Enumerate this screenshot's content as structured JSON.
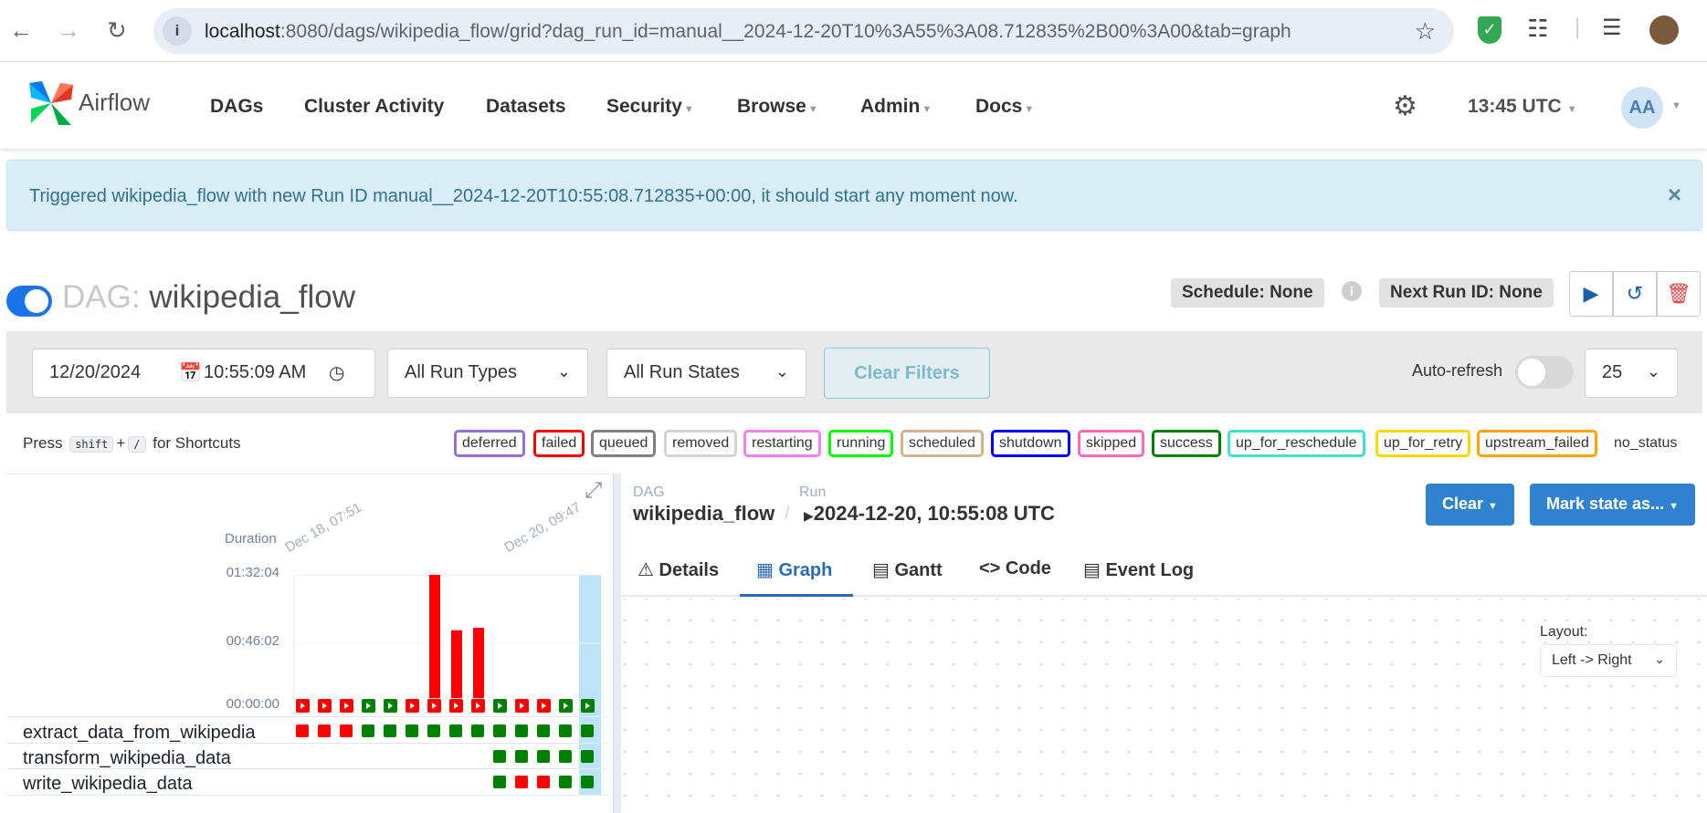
{
  "browser": {
    "url_host": "localhost",
    "url_rest": ":8080/dags/wikipedia_flow/grid?dag_run_id=manual__2024-12-20T10%3A55%3A08.712835%2B00%3A00&tab=graph"
  },
  "navbar": {
    "brand": "Airflow",
    "items": [
      "DAGs",
      "Cluster Activity",
      "Datasets",
      "Security",
      "Browse",
      "Admin",
      "Docs"
    ],
    "time": "13:45 UTC",
    "user_initials": "AA"
  },
  "alert": {
    "message": "Triggered wikipedia_flow with new Run ID manual__2024-12-20T10:55:08.712835+00:00, it should start any moment now.",
    "close": "×"
  },
  "dag": {
    "label": "DAG:",
    "name": "wikipedia_flow",
    "schedule": "Schedule: None",
    "next_run": "Next Run ID: None"
  },
  "filters": {
    "date": "12/20/2024",
    "time": "10:55:09  AM",
    "run_types": "All Run Types",
    "run_states": "All Run States",
    "clear_filters": "Clear Filters",
    "auto_refresh": "Auto-refresh",
    "page_size": "25"
  },
  "shortcuts": {
    "press": "Press",
    "key1": "shift",
    "plus": "+",
    "key2": "/",
    "suffix": "for Shortcuts"
  },
  "states": [
    {
      "label": "deferred",
      "color": "#9370db"
    },
    {
      "label": "failed",
      "color": "#ff0000"
    },
    {
      "label": "queued",
      "color": "#808080"
    },
    {
      "label": "removed",
      "color": "#d3d3d3"
    },
    {
      "label": "restarting",
      "color": "#ee82ee"
    },
    {
      "label": "running",
      "color": "#00ff00"
    },
    {
      "label": "scheduled",
      "color": "#d2b48c"
    },
    {
      "label": "shutdown",
      "color": "#0000ff"
    },
    {
      "label": "skipped",
      "color": "#ff69b4"
    },
    {
      "label": "success",
      "color": "#008000"
    },
    {
      "label": "up_for_reschedule",
      "color": "#40e0d0"
    },
    {
      "label": "up_for_retry",
      "color": "#ffd700"
    },
    {
      "label": "upstream_failed",
      "color": "#ffa500"
    }
  ],
  "no_status": "no_status",
  "grid": {
    "duration_label": "Duration",
    "y_ticks": [
      "01:32:04",
      "00:46:02",
      "00:00:00"
    ],
    "date_labels": [
      "Dec 18, 07:51",
      "Dec 20, 09:47"
    ],
    "runs": [
      {
        "state": "failed",
        "duration_frac": 0.0
      },
      {
        "state": "failed",
        "duration_frac": 0.0
      },
      {
        "state": "failed",
        "duration_frac": 0.0
      },
      {
        "state": "success",
        "duration_frac": 0.0
      },
      {
        "state": "success",
        "duration_frac": 0.0
      },
      {
        "state": "failed",
        "duration_frac": 0.0
      },
      {
        "state": "failed",
        "duration_frac": 1.0
      },
      {
        "state": "failed",
        "duration_frac": 0.55
      },
      {
        "state": "failed",
        "duration_frac": 0.57
      },
      {
        "state": "success",
        "duration_frac": 0.0
      },
      {
        "state": "failed",
        "duration_frac": 0.0
      },
      {
        "state": "failed",
        "duration_frac": 0.0
      },
      {
        "state": "success",
        "duration_frac": 0.0
      },
      {
        "state": "success",
        "duration_frac": 0.0
      }
    ],
    "tasks": [
      {
        "name": "extract_data_from_wikipedia",
        "states": [
          "failed",
          "failed",
          "failed",
          "success",
          "success",
          "success",
          "success",
          "success",
          "success",
          "success",
          "success",
          "success",
          "success",
          "success"
        ]
      },
      {
        "name": "transform_wikipedia_data",
        "states": [
          null,
          null,
          null,
          null,
          null,
          null,
          null,
          null,
          null,
          "success",
          "success",
          "success",
          "success",
          "success"
        ]
      },
      {
        "name": "write_wikipedia_data",
        "states": [
          null,
          null,
          null,
          null,
          null,
          null,
          null,
          null,
          null,
          "success",
          "failed",
          "failed",
          "success",
          "success"
        ]
      }
    ]
  },
  "details": {
    "dag_label": "DAG",
    "dag_name": "wikipedia_flow",
    "sep": "/",
    "run_label": "Run",
    "run_value": "2024-12-20, 10:55:08 UTC",
    "clear_btn": "Clear",
    "mark_btn": "Mark state as...",
    "tabs": [
      "Details",
      "Graph",
      "Gantt",
      "Code",
      "Event Log"
    ],
    "layout_label": "Layout:",
    "layout_value": "Left -> Right"
  },
  "colors": {
    "success": "#008000",
    "failed": "#ff0000",
    "accent": "#3182ce"
  }
}
